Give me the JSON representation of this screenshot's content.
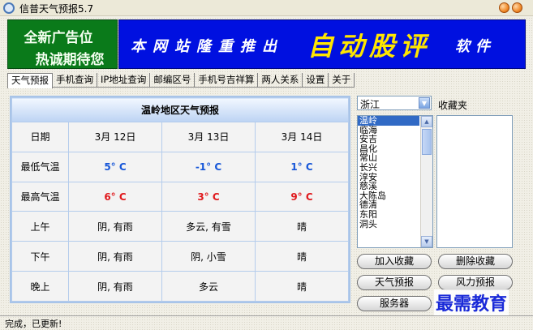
{
  "window": {
    "title": "信普天气预报5.7"
  },
  "banner": {
    "ad_line1": "全新广告位",
    "ad_line2": "热诚期待您",
    "promo_part1": "本网站隆重推出",
    "promo_part2": "自动股评",
    "promo_part3": "软件"
  },
  "tabs": [
    {
      "label": "天气预报",
      "active": true
    },
    {
      "label": "手机查询"
    },
    {
      "label": "IP地址查询"
    },
    {
      "label": "邮编区号"
    },
    {
      "label": "手机号吉祥算"
    },
    {
      "label": "两人关系"
    },
    {
      "label": "设置"
    },
    {
      "label": "关于"
    }
  ],
  "forecast": {
    "caption": "温岭地区天气预报",
    "row_labels": {
      "date": "日期",
      "low": "最低气温",
      "high": "最高气温",
      "morning": "上午",
      "afternoon": "下午",
      "evening": "晚上"
    },
    "days": [
      {
        "date": "3月 12日",
        "low": "5° C",
        "high": "6° C",
        "morning": "阴, 有雨",
        "afternoon": "阴, 有雨",
        "evening": "阴, 有雨"
      },
      {
        "date": "3月 13日",
        "low": "-1° C",
        "high": "3° C",
        "morning": "多云, 有雪",
        "afternoon": "阴, 小雪",
        "evening": "多云"
      },
      {
        "date": "3月 14日",
        "low": "1° C",
        "high": "9° C",
        "morning": "晴",
        "afternoon": "晴",
        "evening": "晴"
      }
    ]
  },
  "province": {
    "selected": "浙江"
  },
  "favorites": {
    "label": "收藏夹"
  },
  "cities": [
    "温岭",
    "临海",
    "安吉",
    "昌化",
    "常山",
    "长兴",
    "淳安",
    "慈溪",
    "大陈岛",
    "德清",
    "东阳",
    "洞头"
  ],
  "buttons": {
    "add_favorite": "加入收藏",
    "delete_favorite": "删除收藏",
    "weather": "天气预报",
    "wind": "风力预报",
    "server": "服务器"
  },
  "watermark": "最需教育",
  "status": {
    "text": "完成，已更新!"
  },
  "colors": {
    "low_temp": "#1656d8",
    "high_temp": "#e0181c",
    "promo_bg": "#0010e0",
    "promo_highlight": "#ffe600",
    "ad_bg": "#0a7a1a"
  }
}
